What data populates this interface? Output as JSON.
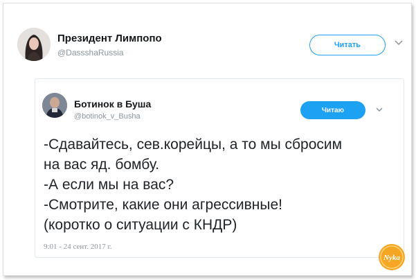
{
  "outer_tweet": {
    "author_name": "Президент Лимпопо",
    "author_handle": "@DassshaRussia",
    "follow_label": "Читать",
    "menu_icon": "chevron-down-icon"
  },
  "quoted_tweet": {
    "author_name": "Ботинок в Буша",
    "author_handle": "@botinok_v_Busha",
    "following_label": "Читаю",
    "menu_icon": "chevron-down-icon",
    "text_lines": [
      "-Сдавайтесь, сев.корейцы, а то мы сбросим",
      "на вас яд. бомбу.",
      "-А если мы на вас?",
      "-Смотрите, какие они агрессивные!",
      "(коротко о ситуации с КНДР)"
    ],
    "timestamp": "9:01 - 24 сент. 2017 г."
  },
  "watermark": {
    "text": "Nyka",
    "color": "#f5a623"
  },
  "colors": {
    "accent": "#1da1f2",
    "text": "#14171a",
    "muted": "#8a949d",
    "border": "#e1e8ed"
  }
}
